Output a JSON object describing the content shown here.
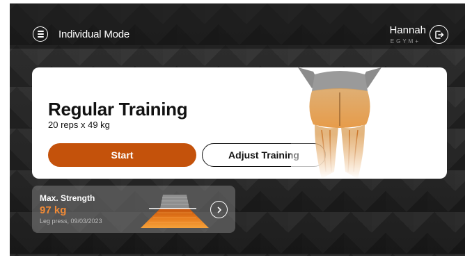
{
  "header": {
    "mode_title": "Individual Mode",
    "user_name": "Hannah",
    "brand": "EGYM+",
    "menu_icon": "menu-icon",
    "logout_icon": "logout-icon"
  },
  "training": {
    "title": "Regular Training",
    "subtitle": "20 reps x 49 kg",
    "start_label": "Start",
    "adjust_label": "Adjust Training"
  },
  "strength": {
    "label": "Max. Strength",
    "value": "97 kg",
    "meta": "Leg press, 09/03/2023",
    "chevron_icon": "chevron-right-icon"
  },
  "colors": {
    "accent": "#c4520b",
    "value_orange": "#f08a36",
    "background": "#2a2a2a",
    "card": "#ffffff"
  }
}
